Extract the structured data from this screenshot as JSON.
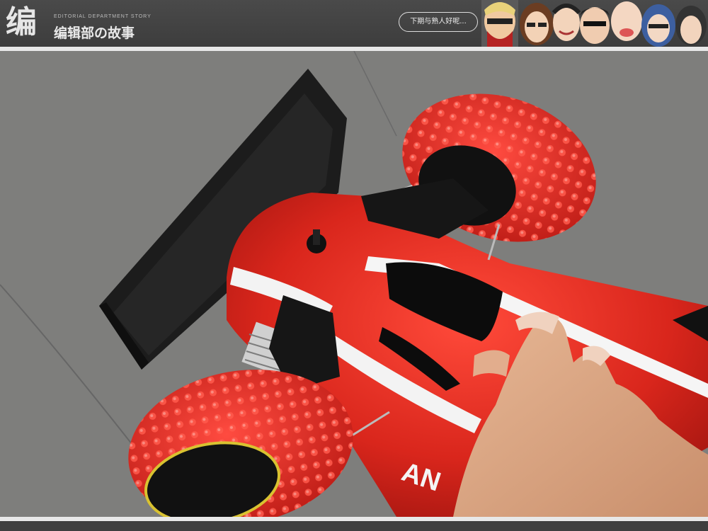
{
  "header": {
    "logo_char": "编",
    "brand_en": "EDITORIAL DEPARTMENT STORY",
    "brand_cn": "编辑部の故事",
    "bubble_text": "下期与熟人好呢..."
  },
  "photo": {
    "subject": "red-rc-car",
    "wheel_color": "#e8261f",
    "body_color": "#d9261c",
    "wing_color": "#1a1a1a",
    "floor_color": "#7e7e7c"
  }
}
